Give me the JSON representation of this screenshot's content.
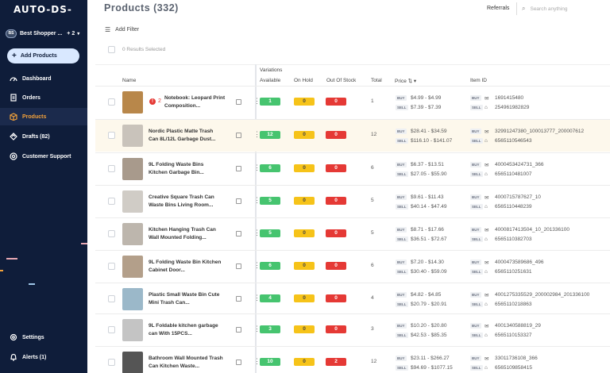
{
  "app": {
    "logo": "AUTO-DS-"
  },
  "sidebar": {
    "shop_avatar": "BS",
    "shop_name": "Best Shopper ...",
    "shop_extra": "+ 2",
    "add_products": "Add Products",
    "items": [
      {
        "label": "Dashboard",
        "icon": "dashboard-icon"
      },
      {
        "label": "Orders",
        "icon": "orders-icon"
      },
      {
        "label": "Products",
        "icon": "box-icon",
        "active": true
      },
      {
        "label": "Drafts (82)",
        "icon": "drafts-icon"
      },
      {
        "label": "Customer Support",
        "icon": "support-icon"
      },
      {
        "label": "Settings",
        "icon": "gear-icon"
      },
      {
        "label": "Alerts (1)",
        "icon": "bell-icon"
      }
    ]
  },
  "header": {
    "title": "Products (332)",
    "referrals": "Referrals",
    "search_placeholder": "Search anything"
  },
  "toolbar": {
    "add_filter": "Add Filter",
    "results": "0 Results Selected"
  },
  "table": {
    "variations_label": "Variations",
    "col_name": "Name",
    "col_available": "Available",
    "col_on_hold": "On Hold",
    "col_out_of_stock": "Out Of Stock",
    "col_total": "Total",
    "col_price": "Price",
    "col_item_id": "Item ID",
    "buy": "BUY",
    "sell": "SELL",
    "rows": [
      {
        "name": "Notebook: Leopard Print Composition...",
        "error": "2",
        "available": "1",
        "on_hold": "0",
        "out_of_stock": "0",
        "total": "1",
        "buy_price": "$4.99 - $4.99",
        "sell_price": "$7.39 - $7.39",
        "buy_id": "1691415480",
        "sell_id": "254961982829",
        "thumb": "#b8874a"
      },
      {
        "name": "Nordic Plastic Matte Trash Can 8L/12L Garbage Dust...",
        "available": "12",
        "on_hold": "0",
        "out_of_stock": "0",
        "total": "12",
        "buy_price": "$28.41 - $34.59",
        "sell_price": "$116.10 - $141.07",
        "buy_id": "32991247380_100013777_200007612",
        "sell_id": "6565110546543",
        "thumb": "#c9c3bb"
      },
      {
        "name": "9L Folding Waste Bins Kitchen Garbage Bin...",
        "available": "6",
        "on_hold": "0",
        "out_of_stock": "0",
        "total": "6",
        "buy_price": "$6.37 - $13.51",
        "sell_price": "$27.05 - $55.90",
        "buy_id": "4000453424731_366",
        "sell_id": "6565110481007",
        "thumb": "#a89a8c"
      },
      {
        "name": "Creative Square Trash Can Waste Bins Living Room...",
        "available": "5",
        "on_hold": "0",
        "out_of_stock": "0",
        "total": "5",
        "buy_price": "$9.61 - $11.43",
        "sell_price": "$40.14 - $47.49",
        "buy_id": "4000715787627_10",
        "sell_id": "6565110448239",
        "thumb": "#d0ccc6"
      },
      {
        "name": "Kitchen Hanging Trash Can Wall Mounted Folding...",
        "available": "5",
        "on_hold": "0",
        "out_of_stock": "0",
        "total": "5",
        "buy_price": "$8.71 - $17.66",
        "sell_price": "$36.51 - $72.67",
        "buy_id": "4000817413504_10_201336100",
        "sell_id": "6565110382703",
        "thumb": "#bdb6ad"
      },
      {
        "name": "9L Folding Waste Bin Kitchen Cabinet Door...",
        "available": "6",
        "on_hold": "0",
        "out_of_stock": "0",
        "total": "6",
        "buy_price": "$7.20 - $14.30",
        "sell_price": "$30.40 - $59.09",
        "buy_id": "4000473589686_496",
        "sell_id": "6565110251631",
        "thumb": "#b39f8a"
      },
      {
        "name": "Plastic Small Waste Bin Cute Mini Trash Can...",
        "available": "4",
        "on_hold": "0",
        "out_of_stock": "0",
        "total": "4",
        "buy_price": "$4.82 - $4.85",
        "sell_price": "$20.79 - $20.91",
        "buy_id": "4001275335529_200002984_201336100",
        "sell_id": "6565110218863",
        "thumb": "#9bb8c9"
      },
      {
        "name": "9L Foldable kitchen garbage can With 15PCS...",
        "available": "3",
        "on_hold": "0",
        "out_of_stock": "0",
        "total": "3",
        "buy_price": "$10.20 - $20.80",
        "sell_price": "$42.53 - $85.35",
        "buy_id": "4001340588819_29",
        "sell_id": "6565110153327",
        "thumb": "#c4c4c4"
      },
      {
        "name": "Bathroom Wall Mounted Trash Can Kitchen Waste...",
        "available": "10",
        "on_hold": "0",
        "out_of_stock": "2",
        "total": "12",
        "buy_price": "$23.11 - $266.27",
        "sell_price": "$94.69 - $1077.15",
        "buy_id": "33011736108_366",
        "sell_id": "6565109858415",
        "thumb": "#555555"
      }
    ]
  },
  "colors": {
    "sidebar_bg": "#0f1d3a",
    "accent": "#f2a13a",
    "available": "#46c46f",
    "on_hold": "#f6c319",
    "out_of_stock": "#e53935"
  }
}
